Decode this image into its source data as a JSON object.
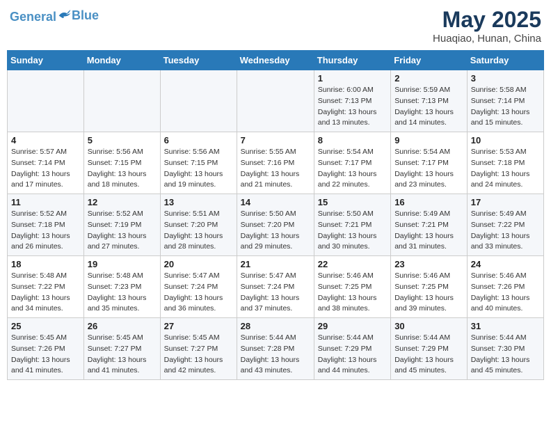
{
  "header": {
    "logo_line1": "General",
    "logo_line2": "Blue",
    "title": "May 2025",
    "subtitle": "Huaqiao, Hunan, China"
  },
  "weekdays": [
    "Sunday",
    "Monday",
    "Tuesday",
    "Wednesday",
    "Thursday",
    "Friday",
    "Saturday"
  ],
  "weeks": [
    [
      {
        "day": "",
        "info": ""
      },
      {
        "day": "",
        "info": ""
      },
      {
        "day": "",
        "info": ""
      },
      {
        "day": "",
        "info": ""
      },
      {
        "day": "1",
        "info": "Sunrise: 6:00 AM\nSunset: 7:13 PM\nDaylight: 13 hours\nand 13 minutes."
      },
      {
        "day": "2",
        "info": "Sunrise: 5:59 AM\nSunset: 7:13 PM\nDaylight: 13 hours\nand 14 minutes."
      },
      {
        "day": "3",
        "info": "Sunrise: 5:58 AM\nSunset: 7:14 PM\nDaylight: 13 hours\nand 15 minutes."
      }
    ],
    [
      {
        "day": "4",
        "info": "Sunrise: 5:57 AM\nSunset: 7:14 PM\nDaylight: 13 hours\nand 17 minutes."
      },
      {
        "day": "5",
        "info": "Sunrise: 5:56 AM\nSunset: 7:15 PM\nDaylight: 13 hours\nand 18 minutes."
      },
      {
        "day": "6",
        "info": "Sunrise: 5:56 AM\nSunset: 7:15 PM\nDaylight: 13 hours\nand 19 minutes."
      },
      {
        "day": "7",
        "info": "Sunrise: 5:55 AM\nSunset: 7:16 PM\nDaylight: 13 hours\nand 21 minutes."
      },
      {
        "day": "8",
        "info": "Sunrise: 5:54 AM\nSunset: 7:17 PM\nDaylight: 13 hours\nand 22 minutes."
      },
      {
        "day": "9",
        "info": "Sunrise: 5:54 AM\nSunset: 7:17 PM\nDaylight: 13 hours\nand 23 minutes."
      },
      {
        "day": "10",
        "info": "Sunrise: 5:53 AM\nSunset: 7:18 PM\nDaylight: 13 hours\nand 24 minutes."
      }
    ],
    [
      {
        "day": "11",
        "info": "Sunrise: 5:52 AM\nSunset: 7:18 PM\nDaylight: 13 hours\nand 26 minutes."
      },
      {
        "day": "12",
        "info": "Sunrise: 5:52 AM\nSunset: 7:19 PM\nDaylight: 13 hours\nand 27 minutes."
      },
      {
        "day": "13",
        "info": "Sunrise: 5:51 AM\nSunset: 7:20 PM\nDaylight: 13 hours\nand 28 minutes."
      },
      {
        "day": "14",
        "info": "Sunrise: 5:50 AM\nSunset: 7:20 PM\nDaylight: 13 hours\nand 29 minutes."
      },
      {
        "day": "15",
        "info": "Sunrise: 5:50 AM\nSunset: 7:21 PM\nDaylight: 13 hours\nand 30 minutes."
      },
      {
        "day": "16",
        "info": "Sunrise: 5:49 AM\nSunset: 7:21 PM\nDaylight: 13 hours\nand 31 minutes."
      },
      {
        "day": "17",
        "info": "Sunrise: 5:49 AM\nSunset: 7:22 PM\nDaylight: 13 hours\nand 33 minutes."
      }
    ],
    [
      {
        "day": "18",
        "info": "Sunrise: 5:48 AM\nSunset: 7:22 PM\nDaylight: 13 hours\nand 34 minutes."
      },
      {
        "day": "19",
        "info": "Sunrise: 5:48 AM\nSunset: 7:23 PM\nDaylight: 13 hours\nand 35 minutes."
      },
      {
        "day": "20",
        "info": "Sunrise: 5:47 AM\nSunset: 7:24 PM\nDaylight: 13 hours\nand 36 minutes."
      },
      {
        "day": "21",
        "info": "Sunrise: 5:47 AM\nSunset: 7:24 PM\nDaylight: 13 hours\nand 37 minutes."
      },
      {
        "day": "22",
        "info": "Sunrise: 5:46 AM\nSunset: 7:25 PM\nDaylight: 13 hours\nand 38 minutes."
      },
      {
        "day": "23",
        "info": "Sunrise: 5:46 AM\nSunset: 7:25 PM\nDaylight: 13 hours\nand 39 minutes."
      },
      {
        "day": "24",
        "info": "Sunrise: 5:46 AM\nSunset: 7:26 PM\nDaylight: 13 hours\nand 40 minutes."
      }
    ],
    [
      {
        "day": "25",
        "info": "Sunrise: 5:45 AM\nSunset: 7:26 PM\nDaylight: 13 hours\nand 41 minutes."
      },
      {
        "day": "26",
        "info": "Sunrise: 5:45 AM\nSunset: 7:27 PM\nDaylight: 13 hours\nand 41 minutes."
      },
      {
        "day": "27",
        "info": "Sunrise: 5:45 AM\nSunset: 7:27 PM\nDaylight: 13 hours\nand 42 minutes."
      },
      {
        "day": "28",
        "info": "Sunrise: 5:44 AM\nSunset: 7:28 PM\nDaylight: 13 hours\nand 43 minutes."
      },
      {
        "day": "29",
        "info": "Sunrise: 5:44 AM\nSunset: 7:29 PM\nDaylight: 13 hours\nand 44 minutes."
      },
      {
        "day": "30",
        "info": "Sunrise: 5:44 AM\nSunset: 7:29 PM\nDaylight: 13 hours\nand 45 minutes."
      },
      {
        "day": "31",
        "info": "Sunrise: 5:44 AM\nSunset: 7:30 PM\nDaylight: 13 hours\nand 45 minutes."
      }
    ]
  ]
}
